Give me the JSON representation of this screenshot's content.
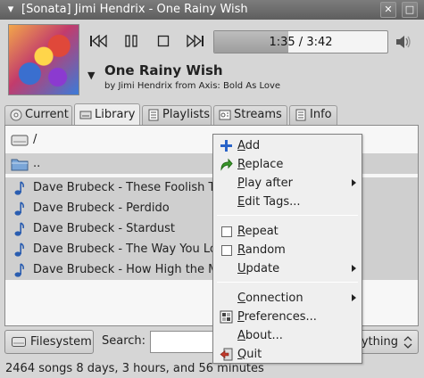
{
  "window": {
    "title": "[Sonata] Jimi Hendrix - One Rainy Wish",
    "close_glyph": "✕",
    "maximize_glyph": "□"
  },
  "player": {
    "progress_text": "1:35 / 3:42",
    "progress_fraction": 0.43,
    "song_title": "One Rainy Wish",
    "song_info": "by Jimi Hendrix from Axis: Bold As Love"
  },
  "tabs": [
    {
      "label": "Current",
      "icon": "disc-icon"
    },
    {
      "label": "Library",
      "icon": "library-icon"
    },
    {
      "label": "Playlists",
      "icon": "list-icon"
    },
    {
      "label": "Streams",
      "icon": "stream-icon"
    },
    {
      "label": "Info",
      "icon": "info-icon"
    }
  ],
  "library": {
    "rows": [
      {
        "label": "/",
        "icon": "drive-icon"
      },
      {
        "label": "..",
        "icon": "folder-icon"
      },
      {
        "label": "Dave Brubeck - These Foolish Things",
        "icon": "music-note-icon"
      },
      {
        "label": "Dave Brubeck - Perdido",
        "icon": "music-note-icon"
      },
      {
        "label": "Dave Brubeck - Stardust",
        "icon": "music-note-icon"
      },
      {
        "label": "Dave Brubeck - The Way You Look Tonight",
        "icon": "music-note-icon"
      },
      {
        "label": "Dave Brubeck - How High the Moon",
        "icon": "music-note-icon"
      }
    ]
  },
  "bottom": {
    "filesystem_label": "Filesystem",
    "search_label": "Search:",
    "search_value": "",
    "search_scope": "Everything"
  },
  "status": {
    "text": "2464 songs   8 days, 3 hours, and 56 minutes"
  },
  "menu": {
    "add": "Add",
    "replace": "Replace",
    "play_after": "Play after",
    "edit_tags": "Edit Tags...",
    "repeat": "Repeat",
    "random": "Random",
    "update": "Update",
    "connection": "Connection",
    "preferences": "Preferences...",
    "about": "About...",
    "quit": "Quit"
  },
  "colors": {
    "selection": "#cfcfcf",
    "note_icon": "#2a5db0",
    "add_icon": "#2a64c8",
    "replace_icon": "#3a9a2a",
    "quit_icon": "#c0392b"
  }
}
